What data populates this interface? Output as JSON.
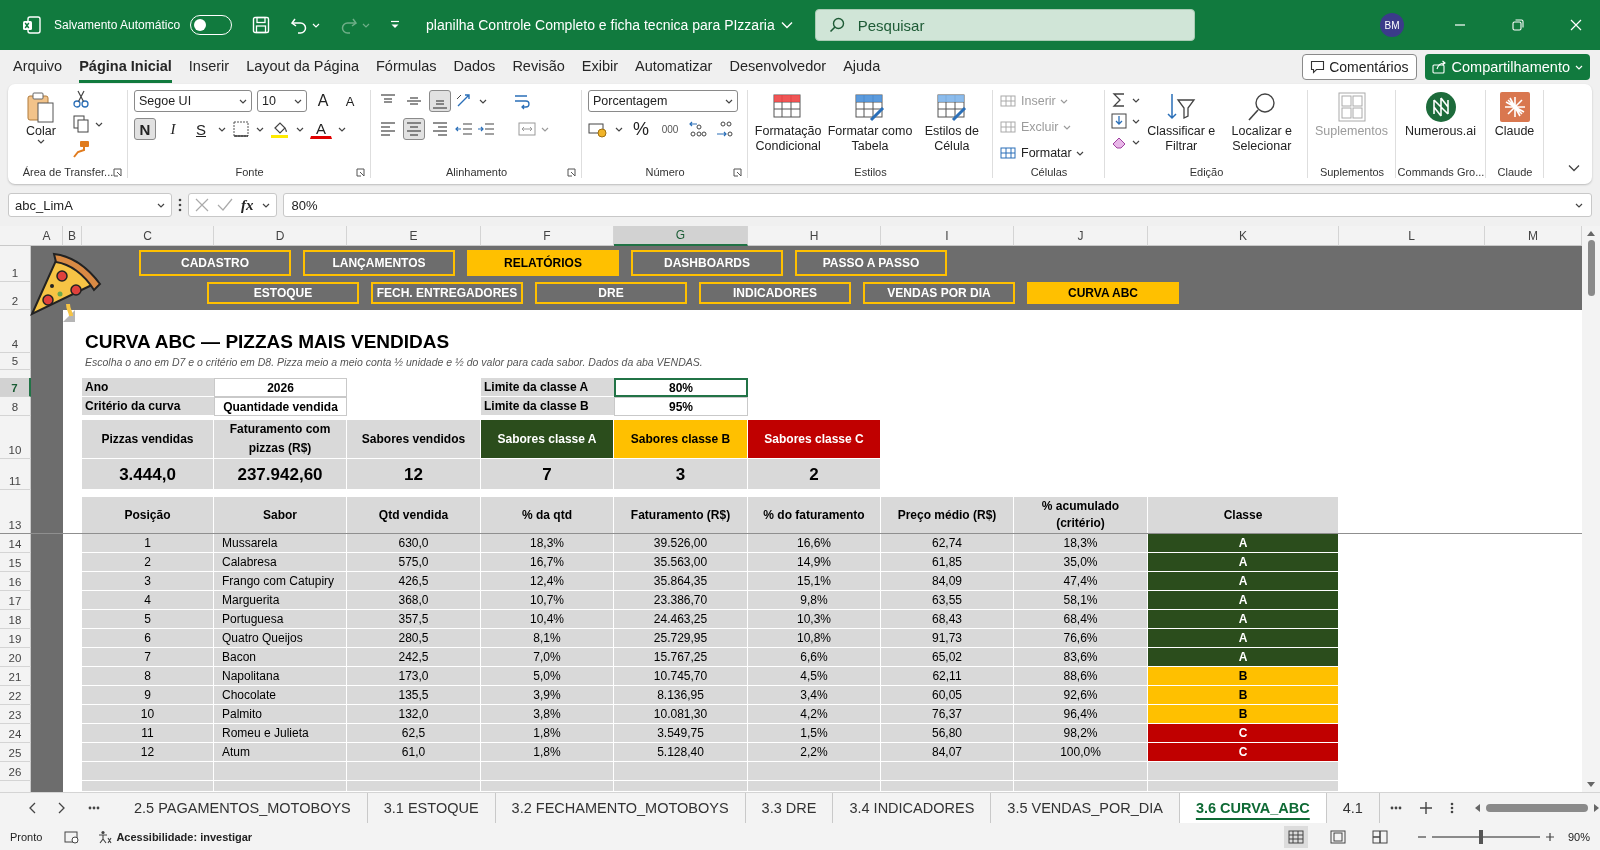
{
  "window": {
    "autosave_label": "Salvamento Automático",
    "autosave_on": false,
    "title": "planilha Controle Completo e ficha tecnica para PIzzaria",
    "search_placeholder": "Pesquisar",
    "user_initials": "BM"
  },
  "menu_tabs": [
    {
      "label": "Arquivo",
      "selected": false
    },
    {
      "label": "Página Inicial",
      "selected": true
    },
    {
      "label": "Inserir",
      "selected": false
    },
    {
      "label": "Layout da Página",
      "selected": false
    },
    {
      "label": "Fórmulas",
      "selected": false
    },
    {
      "label": "Dados",
      "selected": false
    },
    {
      "label": "Revisão",
      "selected": false
    },
    {
      "label": "Exibir",
      "selected": false
    },
    {
      "label": "Automatizar",
      "selected": false
    },
    {
      "label": "Desenvolvedor",
      "selected": false
    },
    {
      "label": "Ajuda",
      "selected": false
    }
  ],
  "comments_button": "Comentários",
  "share_button": "Compartilhamento",
  "ribbon": {
    "clipboard": {
      "label": "Área de Transfer...",
      "paste": "Colar"
    },
    "font": {
      "label": "Fonte",
      "family": "Segoe UI",
      "size": "10",
      "grow": "A",
      "shrink": "A",
      "bold": {
        "label": "N",
        "selected": true
      },
      "italic": {
        "label": "I",
        "selected": false
      },
      "underline": {
        "label": "S",
        "selected": false
      },
      "font_color": "A"
    },
    "alignment": {
      "label": "Alinhamento",
      "vertical": [
        {
          "selected": false
        },
        {
          "selected": false
        },
        {
          "selected": true
        }
      ],
      "horizontal": [
        {
          "selected": false
        },
        {
          "selected": true
        },
        {
          "selected": false
        }
      ]
    },
    "number": {
      "label": "Número",
      "format": "Porcentagem",
      "percent": "%",
      "thousands": "000"
    },
    "styles": {
      "label": "Estilos",
      "buttons": [
        "Formatação Condicional",
        "Formatar como Tabela",
        "Estilos de Célula"
      ]
    },
    "cells": {
      "label": "Células",
      "buttons": [
        {
          "label": "Inserir",
          "disabled": true
        },
        {
          "label": "Excluir",
          "disabled": true
        },
        {
          "label": "Formatar",
          "disabled": false
        }
      ]
    },
    "editing": {
      "label": "Edição",
      "buttons": [
        "Classificar e Filtrar",
        "Localizar e Selecionar"
      ]
    },
    "addins": {
      "label": "Suplementos",
      "button": "Suplementos",
      "disabled": true
    },
    "commands": {
      "label": "Commands Gro...",
      "button": "Numerous.ai"
    },
    "claude": {
      "label": "Claude",
      "button": "Claude"
    }
  },
  "formula_bar": {
    "name_box": "abc_LimA",
    "fx": "fx",
    "value": "80%"
  },
  "columns": [
    {
      "label": "A",
      "selected": false
    },
    {
      "label": "B",
      "selected": false
    },
    {
      "label": "C",
      "selected": false
    },
    {
      "label": "D",
      "selected": false
    },
    {
      "label": "E",
      "selected": false
    },
    {
      "label": "F",
      "selected": false
    },
    {
      "label": "G",
      "selected": true
    },
    {
      "label": "H",
      "selected": false
    },
    {
      "label": "I",
      "selected": false
    },
    {
      "label": "J",
      "selected": false
    },
    {
      "label": "K",
      "selected": false
    },
    {
      "label": "L",
      "selected": false
    },
    {
      "label": "M",
      "selected": false
    }
  ],
  "row_headers": [
    {
      "label": "1",
      "selected": false
    },
    {
      "label": "2",
      "selected": false
    },
    {
      "label": "4",
      "selected": false
    },
    {
      "label": "5",
      "selected": false
    },
    {
      "label": "7",
      "selected": true
    },
    {
      "label": "8",
      "selected": false
    },
    {
      "label": "10",
      "selected": false
    },
    {
      "label": "11",
      "selected": false
    },
    {
      "label": "13",
      "selected": false
    },
    {
      "label": "14",
      "selected": false
    },
    {
      "label": "15",
      "selected": false
    },
    {
      "label": "16",
      "selected": false
    },
    {
      "label": "17",
      "selected": false
    },
    {
      "label": "18",
      "selected": false
    },
    {
      "label": "19",
      "selected": false
    },
    {
      "label": "20",
      "selected": false
    },
    {
      "label": "21",
      "selected": false
    },
    {
      "label": "22",
      "selected": false
    },
    {
      "label": "23",
      "selected": false
    },
    {
      "label": "24",
      "selected": false
    },
    {
      "label": "25",
      "selected": false
    },
    {
      "label": "26",
      "selected": false
    }
  ],
  "nav": {
    "row1": [
      {
        "label": "CADASTRO",
        "selected": false
      },
      {
        "label": "LANÇAMENTOS",
        "selected": false
      },
      {
        "label": "RELATÓRIOS",
        "selected": true
      },
      {
        "label": "DASHBOARDS",
        "selected": false
      },
      {
        "label": "PASSO A PASSO",
        "selected": false
      }
    ],
    "row2": [
      {
        "label": "ESTOQUE",
        "selected": false
      },
      {
        "label": "FECH. ENTREGADORES",
        "selected": false
      },
      {
        "label": "DRE",
        "selected": false
      },
      {
        "label": "INDICADORES",
        "selected": false
      },
      {
        "label": "VENDAS POR DIA",
        "selected": false
      },
      {
        "label": "CURVA ABC",
        "selected": true
      }
    ]
  },
  "title": "CURVA ABC — PIZZAS MAIS VENDIDAS",
  "subtitle": "Escolha o ano em D7 e o critério em D8. Pizza meio a meio conta ½ unidade e ½ do valor para cada sabor. Dados da aba VENDAS.",
  "params": [
    {
      "label": "Ano",
      "value": "2026"
    },
    {
      "label": "Critério da curva",
      "value": "Quantidade vendida"
    }
  ],
  "limits": [
    {
      "label": "Limite da classe A",
      "value": "80%",
      "selected": true
    },
    {
      "label": "Limite da classe B",
      "value": "95%",
      "selected": false
    }
  ],
  "summary": [
    {
      "label": "Pizzas vendidas",
      "value": "3.444,0"
    },
    {
      "label": "Faturamento com pizzas (R$)",
      "value": "237.942,60"
    },
    {
      "label": "Sabores vendidos",
      "value": "12"
    },
    {
      "label": "Sabores classe A",
      "value": "7",
      "color": "#2b4d1c"
    },
    {
      "label": "Sabores classe B",
      "value": "3",
      "color": "#ffc000"
    },
    {
      "label": "Sabores classe C",
      "value": "2",
      "color": "#c00000"
    }
  ],
  "table": {
    "columns": [
      "Posição",
      "Sabor",
      "Qtd vendida",
      "% da qtd",
      "Faturamento (R$)",
      "% do faturamento",
      "Preço médio (R$)",
      "% acumulado (critério)",
      "Classe"
    ],
    "rows": [
      {
        "cells": [
          "1",
          "Mussarela",
          "630,0",
          "18,3%",
          "39.526,00",
          "16,6%",
          "62,74",
          "18,3%",
          "A"
        ],
        "color": "#2b4d1c"
      },
      {
        "cells": [
          "2",
          "Calabresa",
          "575,0",
          "16,7%",
          "35.563,00",
          "14,9%",
          "61,85",
          "35,0%",
          "A"
        ],
        "color": "#2b4d1c"
      },
      {
        "cells": [
          "3",
          "Frango com Catupiry",
          "426,5",
          "12,4%",
          "35.864,35",
          "15,1%",
          "84,09",
          "47,4%",
          "A"
        ],
        "color": "#2b4d1c"
      },
      {
        "cells": [
          "4",
          "Marguerita",
          "368,0",
          "10,7%",
          "23.386,70",
          "9,8%",
          "63,55",
          "58,1%",
          "A"
        ],
        "color": "#2b4d1c"
      },
      {
        "cells": [
          "5",
          "Portuguesa",
          "357,5",
          "10,4%",
          "24.463,25",
          "10,3%",
          "68,43",
          "68,4%",
          "A"
        ],
        "color": "#2b4d1c"
      },
      {
        "cells": [
          "6",
          "Quatro Queijos",
          "280,5",
          "8,1%",
          "25.729,95",
          "10,8%",
          "91,73",
          "76,6%",
          "A"
        ],
        "color": "#2b4d1c"
      },
      {
        "cells": [
          "7",
          "Bacon",
          "242,5",
          "7,0%",
          "15.767,25",
          "6,6%",
          "65,02",
          "83,6%",
          "A"
        ],
        "color": "#2b4d1c"
      },
      {
        "cells": [
          "8",
          "Napolitana",
          "173,0",
          "5,0%",
          "10.745,70",
          "4,5%",
          "62,11",
          "88,6%",
          "B"
        ],
        "color": "#ffc000"
      },
      {
        "cells": [
          "9",
          "Chocolate",
          "135,5",
          "3,9%",
          "8.136,95",
          "3,4%",
          "60,05",
          "92,6%",
          "B"
        ],
        "color": "#ffc000"
      },
      {
        "cells": [
          "10",
          "Palmito",
          "132,0",
          "3,8%",
          "10.081,30",
          "4,2%",
          "76,37",
          "96,4%",
          "B"
        ],
        "color": "#ffc000"
      },
      {
        "cells": [
          "11",
          "Romeu e Julieta",
          "62,5",
          "1,8%",
          "3.549,75",
          "1,5%",
          "56,80",
          "98,2%",
          "C"
        ],
        "color": "#c00000"
      },
      {
        "cells": [
          "12",
          "Atum",
          "61,0",
          "1,8%",
          "5.128,40",
          "2,2%",
          "84,07",
          "100,0%",
          "C"
        ],
        "color": "#c00000"
      }
    ]
  },
  "sheet_tabs": [
    {
      "label": "2.5 PAGAMENTOS_MOTOBOYS",
      "selected": false
    },
    {
      "label": "3.1 ESTOQUE",
      "selected": false
    },
    {
      "label": "3.2 FECHAMENTO_MOTOBOYS",
      "selected": false
    },
    {
      "label": "3.3 DRE",
      "selected": false
    },
    {
      "label": "3.4 INDICADORES",
      "selected": false
    },
    {
      "label": "3.5 VENDAS_POR_DIA",
      "selected": false
    },
    {
      "label": "3.6 CURVA_ABC",
      "selected": true
    },
    {
      "label": "4.1",
      "selected": false
    }
  ],
  "status_bar": {
    "ready": "Pronto",
    "accessibility": "Acessibilidade: investigar",
    "views": [
      {
        "selected": true
      },
      {
        "selected": false
      },
      {
        "selected": false
      }
    ],
    "zoom": {
      "level": 0.45,
      "value": "90%"
    }
  }
}
